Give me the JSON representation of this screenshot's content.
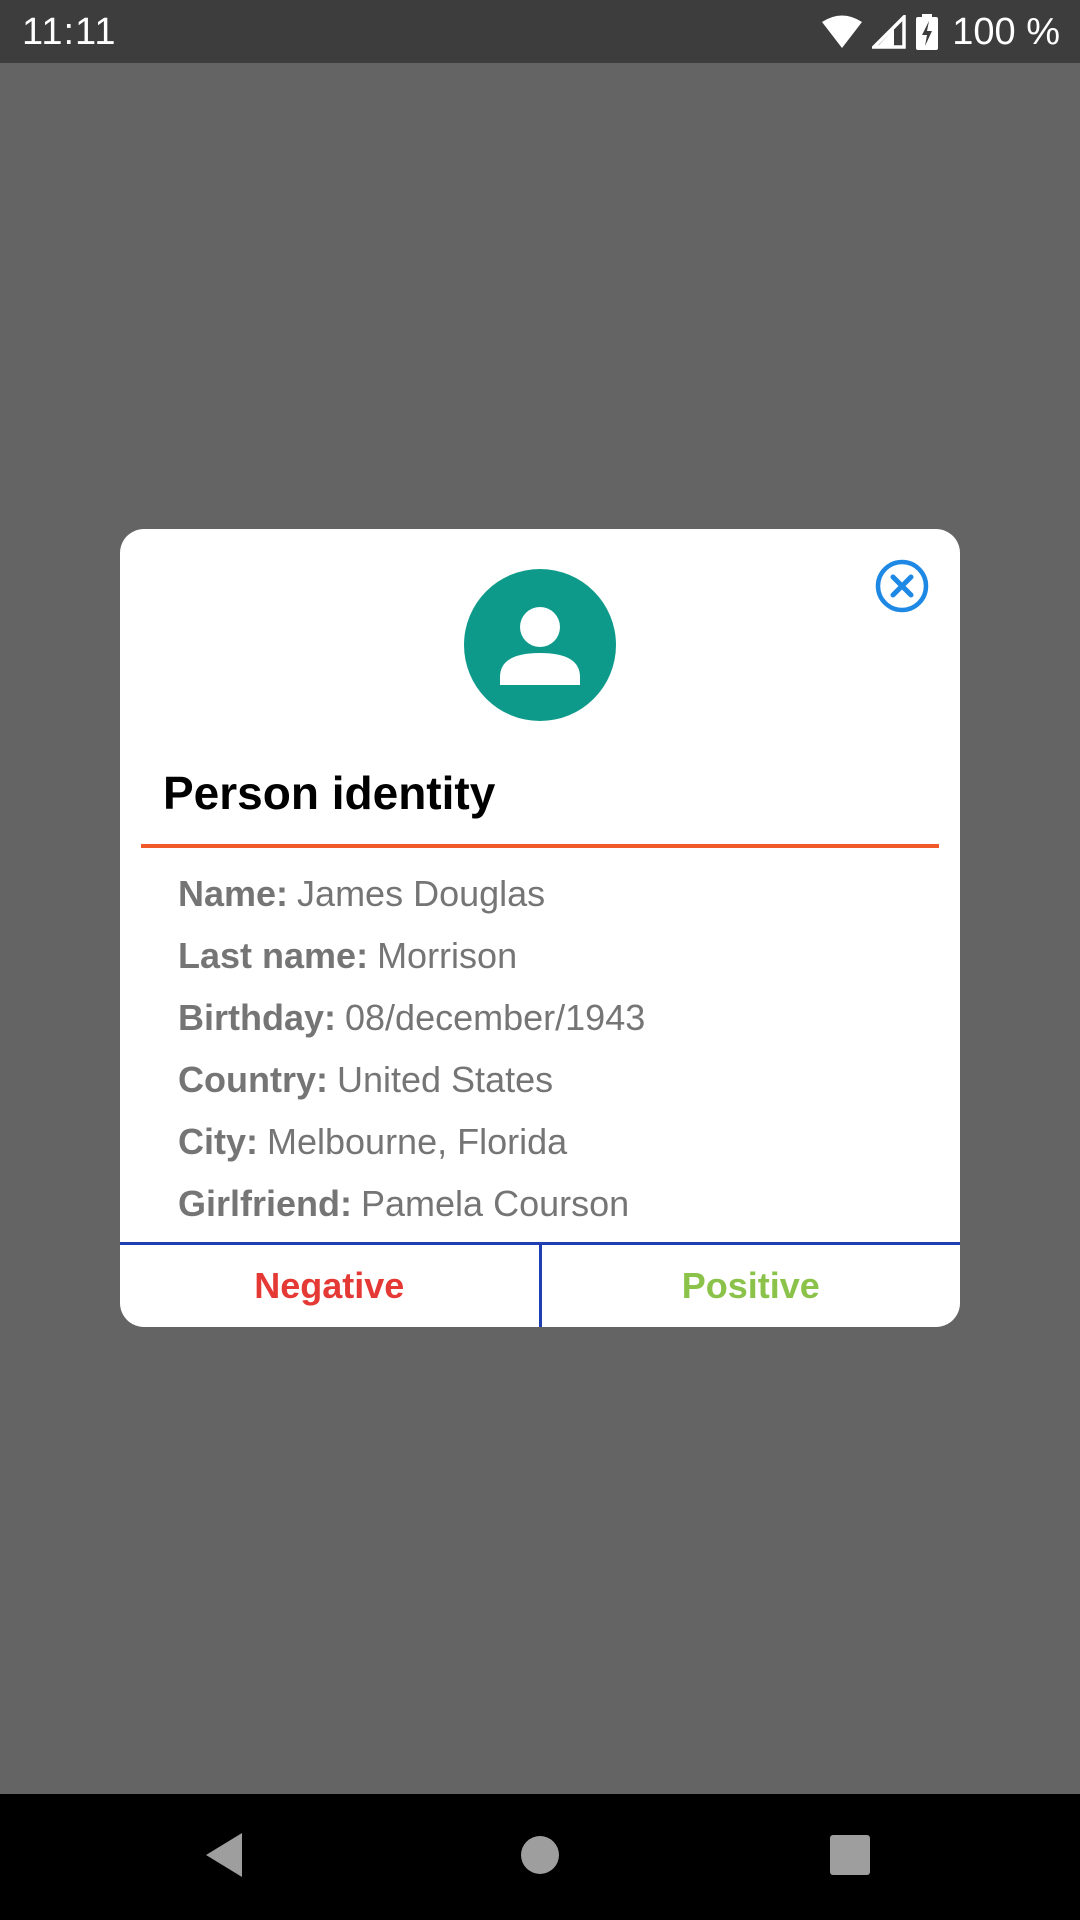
{
  "status_bar": {
    "time": "11:11",
    "battery": "100 %",
    "icons": [
      "wifi-icon",
      "signal-icon",
      "battery-charging-icon"
    ]
  },
  "dialog": {
    "title": "Person identity",
    "avatar_icon": "person-icon",
    "close_icon": "close-circle-icon",
    "fields": [
      {
        "key": "Name:",
        "value": "James Douglas"
      },
      {
        "key": "Last name:",
        "value": "Morrison"
      },
      {
        "key": "Birthday:",
        "value": "08/december/1943"
      },
      {
        "key": "Country:",
        "value": "United States"
      },
      {
        "key": "City:",
        "value": "Melbourne, Florida"
      },
      {
        "key": "Girlfriend:",
        "value": "Pamela Courson"
      }
    ],
    "negative_label": "Negative",
    "positive_label": "Positive"
  },
  "nav_bar": {
    "icons": [
      "back-icon",
      "home-icon",
      "recents-icon"
    ]
  },
  "colors": {
    "accent_teal": "#0e9a8a",
    "divider_orange": "#f05a28",
    "button_border_blue": "#1f3fb3",
    "close_blue": "#1e88e5",
    "negative_red": "#e53935",
    "positive_green": "#8bc34a",
    "scrim": "#646464"
  }
}
